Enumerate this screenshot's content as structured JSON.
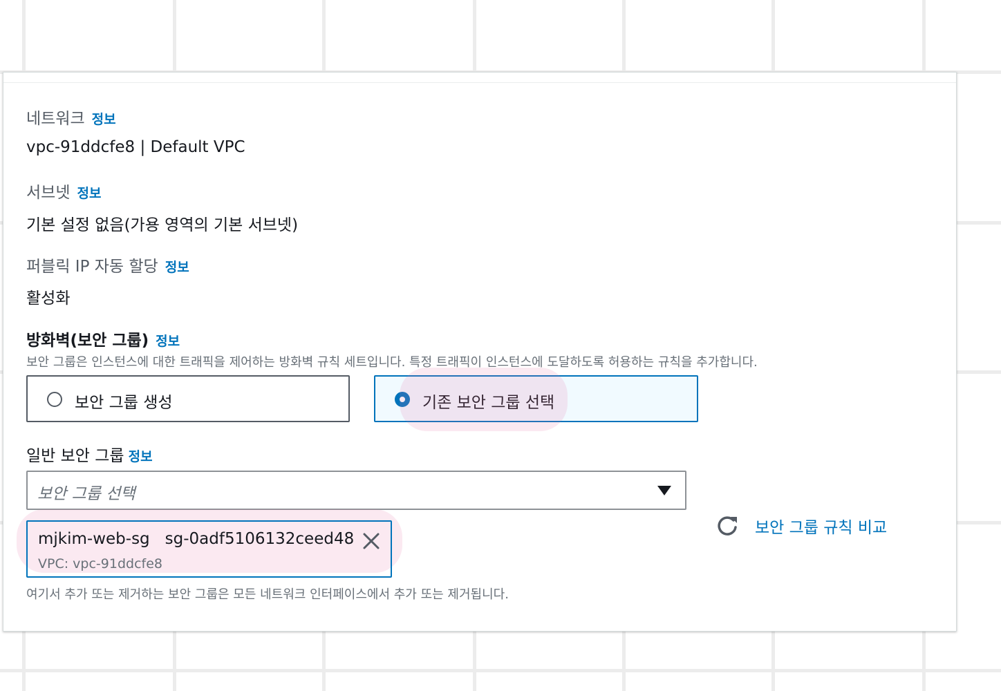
{
  "network": {
    "label": "네트워크",
    "info": "정보",
    "value": "vpc-91ddcfe8 | Default VPC"
  },
  "subnet": {
    "label": "서브넷",
    "info": "정보",
    "value": "기본 설정 없음(가용 영역의 기본 서브넷)"
  },
  "public_ip": {
    "label": "퍼블릭 IP 자동 할당",
    "info": "정보",
    "value": "활성화"
  },
  "firewall": {
    "heading": "방화벽(보안 그룹)",
    "info": "정보",
    "description": "보안 그룹은 인스턴스에 대한 트래픽을 제어하는 방화벽 규칙 세트입니다. 특정 트래픽이 인스턴스에 도달하도록 허용하는 규칙을 추가합니다.",
    "options": [
      {
        "label": "보안 그룹 생성",
        "selected": false
      },
      {
        "label": "기존 보안 그룹 선택",
        "selected": true
      }
    ]
  },
  "common_sg": {
    "label": "일반 보안 그룹",
    "info": "정보",
    "placeholder": "보안 그룹 선택",
    "selected_token": {
      "name": "mjkim-web-sg",
      "id": "sg-0adf5106132ceed48",
      "vpc": "VPC: vpc-91ddcfe8"
    },
    "compare_link": "보안 그룹 규칙 비교",
    "footer_note": "여기서 추가 또는 제거하는 보안 그룹은 모든 네트워크 인터페이스에서 추가 또는 제거됩니다."
  },
  "colors": {
    "link": "#0073bb",
    "selected_bg": "#f1faff",
    "highlight": "#f4dbe8"
  },
  "icons": {
    "refresh": "refresh-icon",
    "close": "close-icon",
    "caret": "caret-down-icon"
  }
}
